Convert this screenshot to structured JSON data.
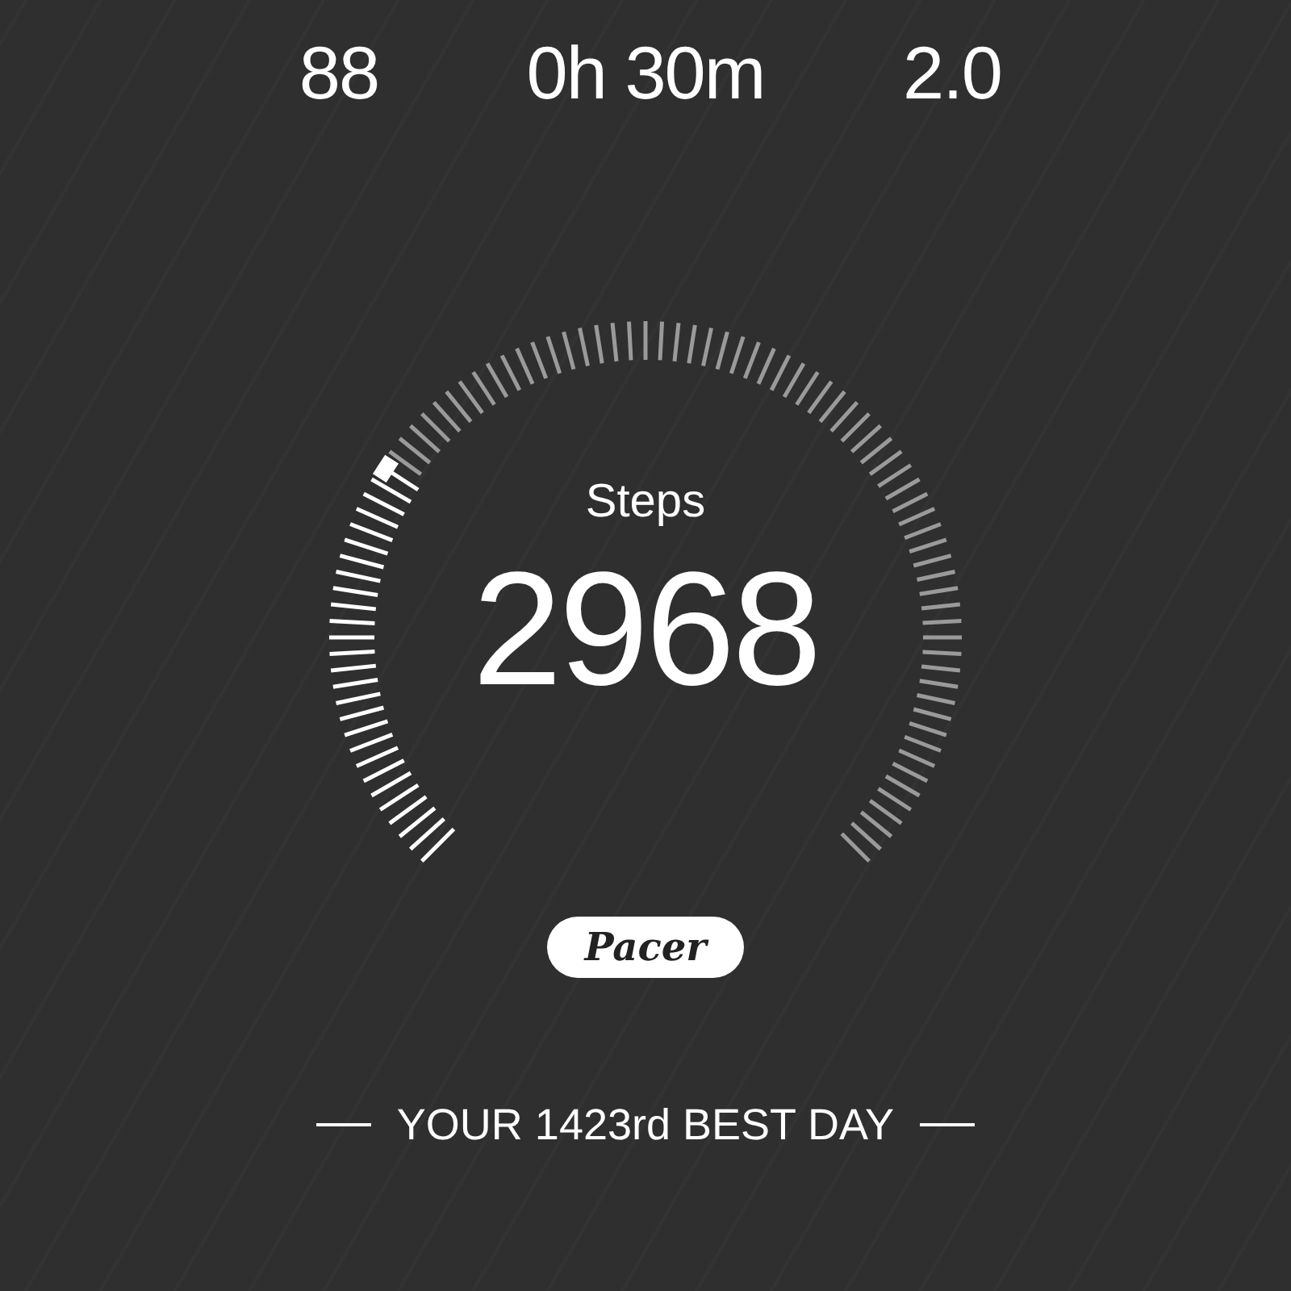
{
  "stats": [
    {
      "value": "88"
    },
    {
      "value": "0h 30m"
    },
    {
      "value": "2.0"
    }
  ],
  "gauge": {
    "label": "Steps",
    "value": "2968"
  },
  "brand": "Pacer",
  "best_day": "YOUR 1423rd BEST DAY"
}
